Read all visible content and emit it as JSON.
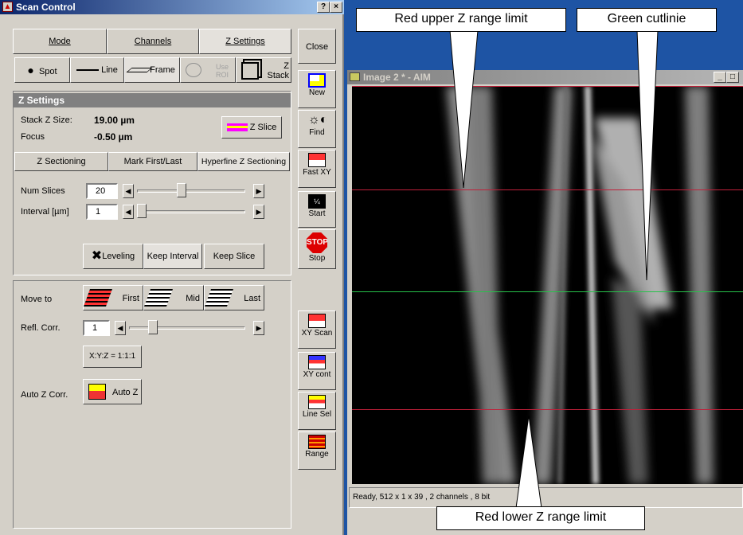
{
  "scan_window": {
    "title": "Scan Control",
    "title_buttons": [
      "?",
      "×"
    ],
    "tabs": [
      {
        "label": "Mode"
      },
      {
        "label": "Channels"
      },
      {
        "label": "Z Settings",
        "active": true
      }
    ],
    "modes": [
      {
        "label": "Spot"
      },
      {
        "label": "Line"
      },
      {
        "label": "Frame",
        "active": true
      },
      {
        "label": "Use ROI"
      },
      {
        "label": "Z Stack"
      }
    ],
    "close_label": "Close",
    "panel_title": "Z Settings",
    "stack_z_size_label": "Stack Z Size:",
    "stack_z_size_value": "19.00 µm",
    "focus_label": "Focus",
    "focus_value": "-0.50 µm",
    "z_slice_label": "Z Slice",
    "subtabs": [
      {
        "label": "Z Sectioning"
      },
      {
        "label": "Mark First/Last"
      },
      {
        "label": "Hyperfine Z Sectioning",
        "active": true
      }
    ],
    "num_slices_label": "Num Slices",
    "num_slices_value": "20",
    "interval_label": "Interval [µm]",
    "interval_value": "1",
    "leveling_label": "Leveling",
    "keep_interval_label": "Keep Interval",
    "keep_slice_label": "Keep Slice",
    "move_to_label": "Move to",
    "first_label": "First",
    "mid_label": "Mid",
    "last_label": "Last",
    "refl_corr_label": "Refl. Corr.",
    "refl_corr_value": "1",
    "xyz_label": "X:Y:Z = 1:1:1",
    "auto_z_corr_label": "Auto Z Corr.",
    "auto_z_label": "Auto Z"
  },
  "side_buttons": [
    {
      "label": "New"
    },
    {
      "label": "Find"
    },
    {
      "label": "Fast XY"
    },
    {
      "label": "Start"
    },
    {
      "label": "Stop"
    },
    {
      "label": "XY Scan"
    },
    {
      "label": "XY cont"
    },
    {
      "label": "Line Sel"
    },
    {
      "label": "Range"
    }
  ],
  "image_window": {
    "title": "Image 2 * - AIM",
    "status": "Ready, 512 x 1 x 39 , 2 channels , 8 bit"
  },
  "annotations": {
    "red_upper": "Red upper Z range limit",
    "green_cut": "Green cutlinie",
    "red_lower": "Red lower Z range limit"
  },
  "colors": {
    "red_line": "#c0203a",
    "green_line": "#27c24a",
    "title_active": "#0a246a"
  }
}
